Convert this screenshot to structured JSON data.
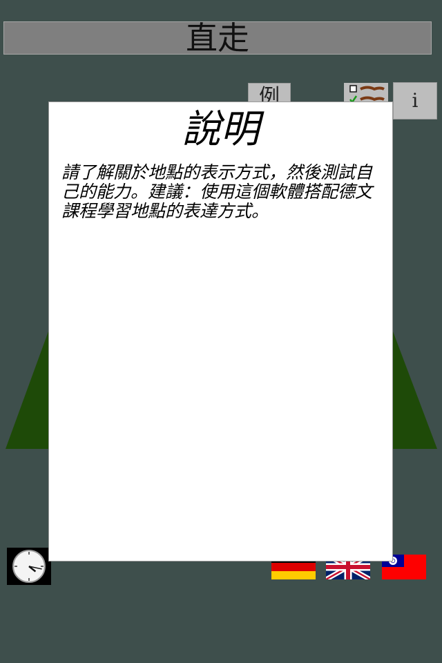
{
  "header": {
    "title": "直走"
  },
  "toolbar": {
    "example_label": "例",
    "info_label": "i",
    "checklist_icon": "checklist-icon"
  },
  "scene": {
    "road_color": "#1e4a08",
    "background_color": "#3e4f4c"
  },
  "clock": {
    "hour": 4,
    "minute": 17
  },
  "languages": [
    {
      "name": "German",
      "flag": "de-flag-icon"
    },
    {
      "name": "English",
      "flag": "uk-flag-icon"
    },
    {
      "name": "Chinese (Taiwan)",
      "flag": "tw-flag-icon"
    }
  ],
  "dialog": {
    "title": "說明",
    "body": "請了解關於地點的表示方式，然後測試自己的能力。建議：使用這個軟體搭配德文課程學習地點的表達方式。"
  }
}
